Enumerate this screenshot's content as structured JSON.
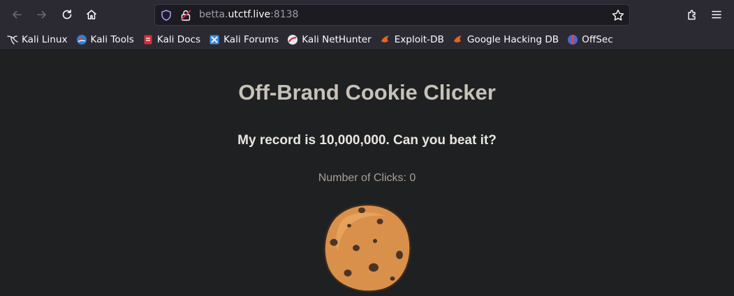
{
  "browser": {
    "url_prefix": "betta.",
    "url_host": "utctf.live",
    "url_port": ":8138"
  },
  "bookmarks": [
    {
      "label": "Kali Linux",
      "icon": "kali-dragon-icon"
    },
    {
      "label": "Kali Tools",
      "icon": "kali-tools-icon"
    },
    {
      "label": "Kali Docs",
      "icon": "kali-docs-icon"
    },
    {
      "label": "Kali Forums",
      "icon": "kali-forums-icon"
    },
    {
      "label": "Kali NetHunter",
      "icon": "kali-nethunter-icon"
    },
    {
      "label": "Exploit-DB",
      "icon": "exploit-db-icon"
    },
    {
      "label": "Google Hacking DB",
      "icon": "ghdb-icon"
    },
    {
      "label": "OffSec",
      "icon": "offsec-icon"
    }
  ],
  "page": {
    "title": "Off-Brand Cookie Clicker",
    "record": "My record is 10,000,000. Can you beat it?",
    "clicks_text": "Number of Clicks: 0"
  },
  "colors": {
    "page_bg": "#1f2021",
    "toolbar_bg": "#2b2a33",
    "cookie": "#d9904a"
  }
}
